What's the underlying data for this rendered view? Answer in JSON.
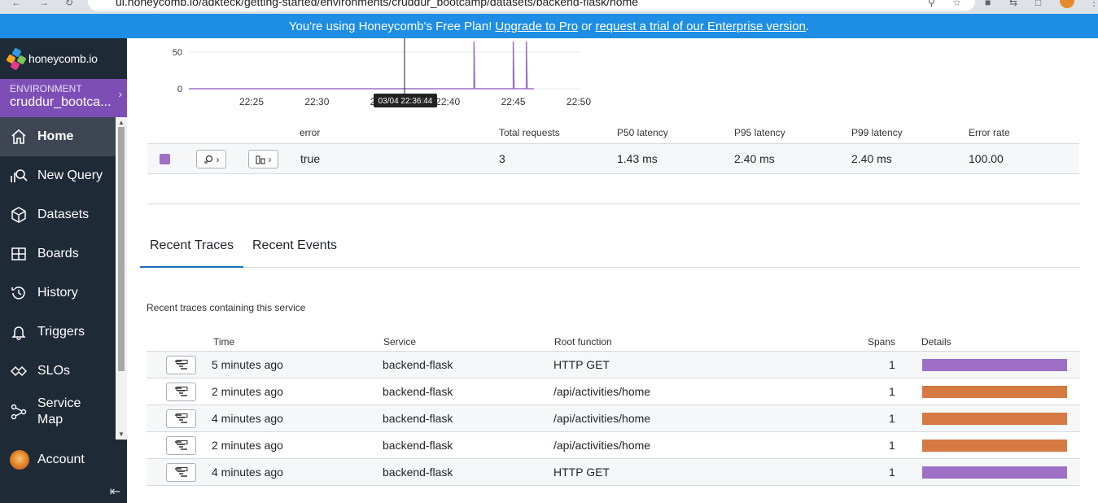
{
  "browser": {
    "url": "ui.honeycomb.io/adkteck/getting-started/environments/cruddur_bootcamp/datasets/backend-flask/home"
  },
  "banner": {
    "text_before": "You're using Honeycomb's Free Plan!",
    "upgrade_link": "Upgrade to Pro",
    "middle": "or",
    "trial_link": "request a trial of our Enterprise version",
    "text_after": "."
  },
  "sidebar": {
    "logo_text": "honeycomb.io",
    "environment_label": "ENVIRONMENT",
    "environment_name": "cruddur_bootca...",
    "items": [
      {
        "label": "Home",
        "icon": "home-icon",
        "active": true
      },
      {
        "label": "New Query",
        "icon": "query-icon"
      },
      {
        "label": "Datasets",
        "icon": "cube-icon"
      },
      {
        "label": "Boards",
        "icon": "grid-icon"
      },
      {
        "label": "History",
        "icon": "history-icon"
      },
      {
        "label": "Triggers",
        "icon": "bell-icon"
      },
      {
        "label": "SLOs",
        "icon": "slo-icon"
      },
      {
        "label": "Service Map",
        "icon": "service-map-icon"
      }
    ],
    "account_label": "Account"
  },
  "chart_data": {
    "type": "line",
    "yticks": [
      "50",
      "0"
    ],
    "xticks": [
      "22:25",
      "22:30",
      "22:35",
      "22:40",
      "22:45",
      "22:50"
    ],
    "series_color": "#9d70c6",
    "spikes": [
      {
        "x": "22:42",
        "y": 60
      },
      {
        "x": "22:45",
        "y": 60
      },
      {
        "x": "22:46",
        "y": 60
      }
    ],
    "cursor_label": "03/04 22:36:44"
  },
  "breakdown": {
    "headers": [
      "error",
      "Total requests",
      "P50 latency",
      "P95 latency",
      "P99 latency",
      "Error rate"
    ],
    "rows": [
      {
        "error": "true",
        "total_requests": "3",
        "p50": "1.43 ms",
        "p95": "2.40 ms",
        "p99": "2.40 ms",
        "error_rate": "100.00"
      }
    ]
  },
  "tabs": [
    {
      "label": "Recent Traces",
      "active": true
    },
    {
      "label": "Recent Events",
      "active": false
    }
  ],
  "traces": {
    "caption": "Recent traces containing this service",
    "headers": [
      "Time",
      "Service",
      "Root function",
      "Spans",
      "Details"
    ],
    "rows": [
      {
        "time": "5 minutes ago",
        "service": "backend-flask",
        "root": "HTTP GET",
        "spans": "1",
        "color": "#9d70c6"
      },
      {
        "time": "2 minutes ago",
        "service": "backend-flask",
        "root": "/api/activities/home",
        "spans": "1",
        "color": "#d47a42"
      },
      {
        "time": "4 minutes ago",
        "service": "backend-flask",
        "root": "/api/activities/home",
        "spans": "1",
        "color": "#d47a42"
      },
      {
        "time": "2 minutes ago",
        "service": "backend-flask",
        "root": "/api/activities/home",
        "spans": "1",
        "color": "#d47a42"
      },
      {
        "time": "4 minutes ago",
        "service": "backend-flask",
        "root": "HTTP GET",
        "spans": "1",
        "color": "#9d70c6"
      }
    ]
  }
}
